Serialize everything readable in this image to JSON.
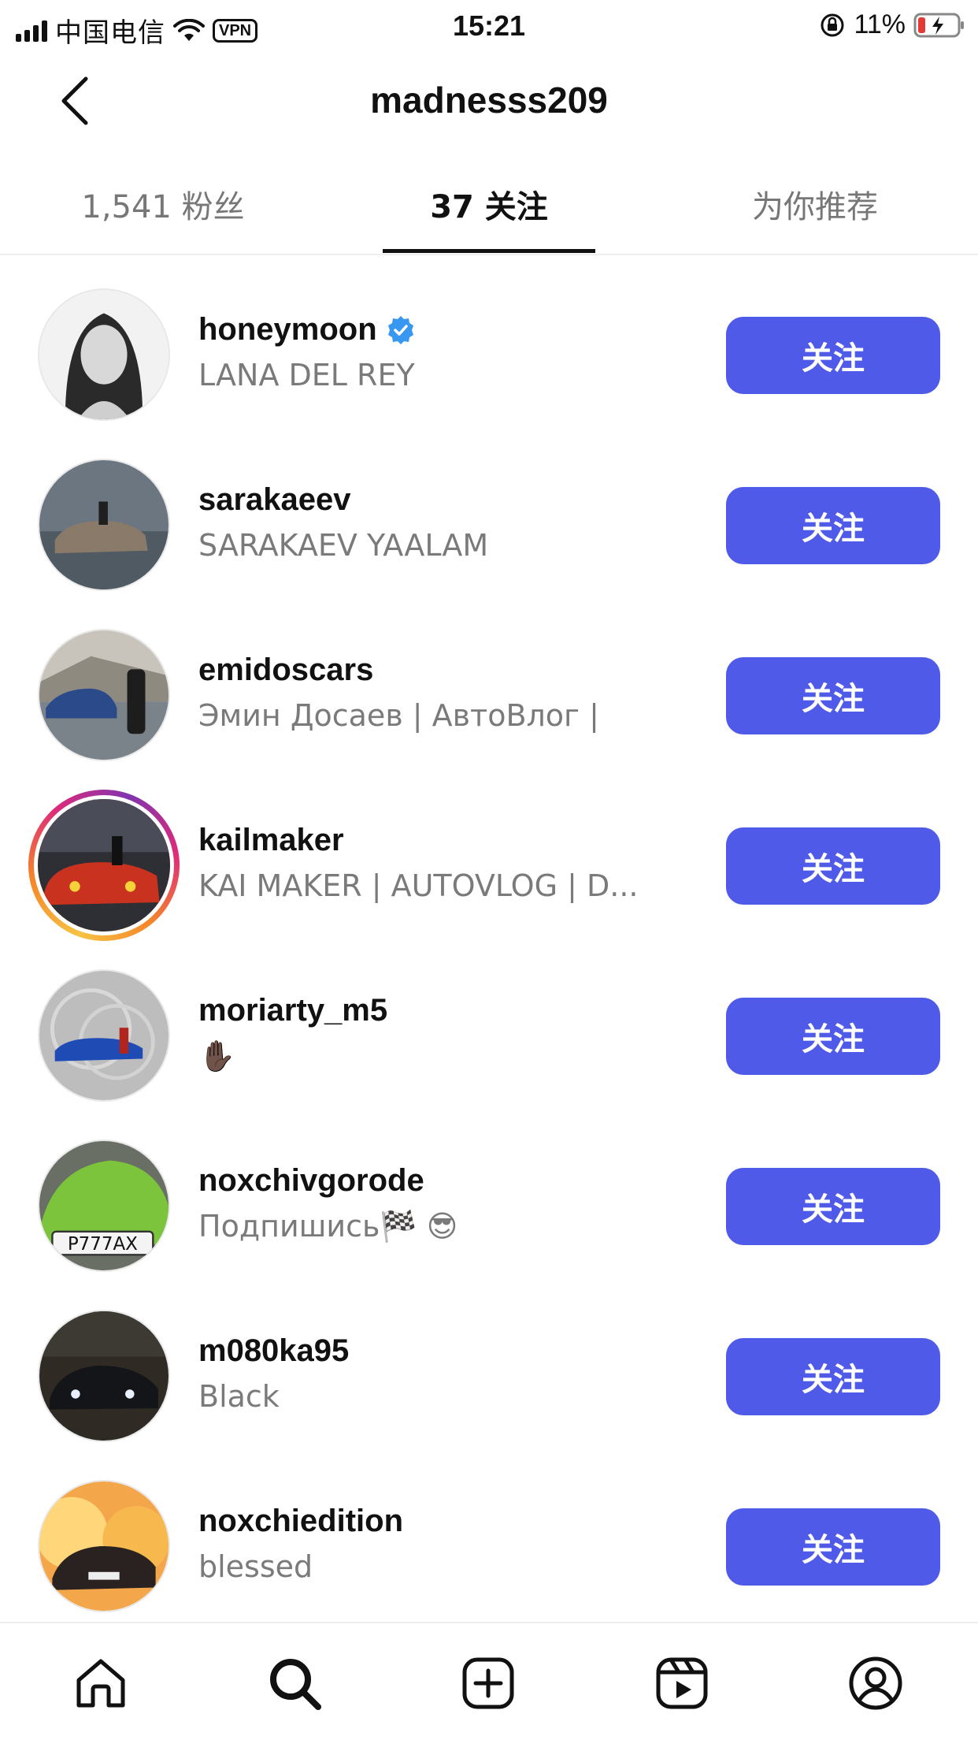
{
  "status_bar": {
    "carrier": "中国电信",
    "vpn": "VPN",
    "time": "15:21",
    "battery": "11%",
    "battery_color": "#e53935"
  },
  "header": {
    "back_icon": "chevron-left-icon",
    "title": "madnesss209"
  },
  "tabs": [
    {
      "label": "1,541 粉丝",
      "active": false
    },
    {
      "label": "37 关注",
      "active": true
    },
    {
      "label": "为你推荐",
      "active": false
    }
  ],
  "following": [
    {
      "username": "honeymoon",
      "verified": true,
      "subtitle": "LANA DEL REY",
      "button": "关注",
      "story": false,
      "avatar_color": "#9a9a9a"
    },
    {
      "username": "sarakaeev",
      "verified": false,
      "subtitle": "SARAKAEV YAALAM",
      "button": "关注",
      "story": false,
      "avatar_color": "#5d6a74"
    },
    {
      "username": "emidoscars",
      "verified": false,
      "subtitle": "Эмин Досаев | АвтоВлог |",
      "button": "关注",
      "story": false,
      "avatar_color": "#6f7c88"
    },
    {
      "username": "kailmaker",
      "verified": false,
      "subtitle": "KAI MAKER | AUTOVLOG | D...",
      "button": "关注",
      "story": true,
      "avatar_color": "#3a3a40"
    },
    {
      "username": "moriarty_m5",
      "verified": false,
      "subtitle": "✋🏿",
      "button": "关注",
      "story": false,
      "avatar_color": "#b9b9b9"
    },
    {
      "username": "noxchivgorode",
      "verified": false,
      "subtitle": "Подпишись🏁 😎",
      "button": "关注",
      "story": false,
      "avatar_color": "#7cc43c"
    },
    {
      "username": "m080ka95",
      "verified": false,
      "subtitle": "Black",
      "button": "关注",
      "story": false,
      "avatar_color": "#232528"
    },
    {
      "username": "noxchiedition",
      "verified": false,
      "subtitle": "blessed",
      "button": "关注",
      "story": false,
      "avatar_color": "#d9772a"
    }
  ],
  "bottom_nav": [
    {
      "name": "home-icon"
    },
    {
      "name": "search-icon"
    },
    {
      "name": "create-icon"
    },
    {
      "name": "reels-icon"
    },
    {
      "name": "profile-icon"
    }
  ],
  "colors": {
    "follow_button": "#4f5ae8",
    "verified_badge": "#3897f0"
  }
}
